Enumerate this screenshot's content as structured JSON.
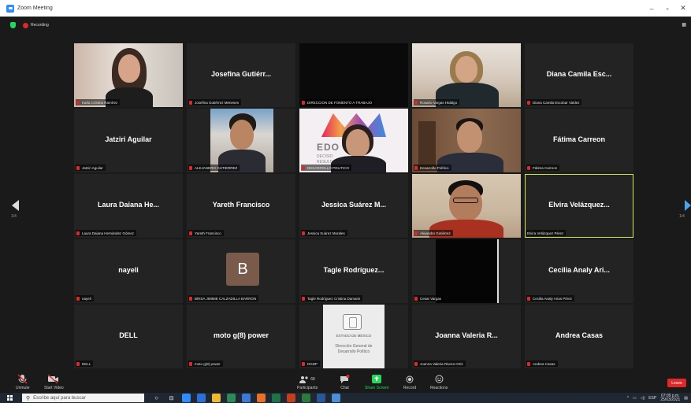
{
  "window": {
    "title": "Zoom Meeting",
    "minimize": "–",
    "maximize": "▫",
    "close": "✕"
  },
  "recording": {
    "label": "Recording"
  },
  "gallery": {
    "page_left": "1/4",
    "page_right": "1/4",
    "tiles": [
      {
        "label": "Karla Cristina Ramírez"
      },
      {
        "name": "Josefina Gutiérr...",
        "label": "Josefina Gutiérrez Meneses"
      },
      {
        "label": "DIRECCION DE FOMENTO A TRABAJO"
      },
      {
        "label": "Rosario Vargas Hidalgo"
      },
      {
        "name": "Diana Camila Esc...",
        "label": "Diana Camila Escobar Valdez"
      },
      {
        "name": "Jatziri Aguilar",
        "label": "Jatziri Aguilar"
      },
      {
        "label": "ALEJANDRO GUTIERREZ"
      },
      {
        "edo": "EDO",
        "edo_sub1": "DECISIO",
        "edo_sub2": "RESULT",
        "label": "DESARROLLO POLITICO"
      },
      {
        "label": "Desarrollo Político"
      },
      {
        "name": "Fátima Carreon",
        "label": "Fátima Carreon"
      },
      {
        "name": "Laura Daiana He...",
        "label": "Laura Daiana Hernández Gómez"
      },
      {
        "name": "Yareth Francisco",
        "label": "Yareth Francisco"
      },
      {
        "name": "Jessica Suárez M...",
        "label": "Jessica Suárez Morales"
      },
      {
        "label": "Alejandro Gutiérrez"
      },
      {
        "name": "Elvira Velázquez...",
        "label": "Elvira Velázquez Pérez"
      },
      {
        "name": "nayeli",
        "label": "nayeli"
      },
      {
        "avatar": "B",
        "label": "BRISA JIMMIE CALZADILLA BARRON"
      },
      {
        "name": "Tagle Rodríguez...",
        "label": "Tagle Rodríguez Cristina Damaris"
      },
      {
        "label": "Cesar Vargas"
      },
      {
        "name": "Cecilia Analy Ari...",
        "label": "Cecilia Analy Arias Pérez"
      },
      {
        "name": "DELL",
        "label": "DELL"
      },
      {
        "name": "moto g(8) power",
        "label": "moto g(8) power"
      },
      {
        "seal_title": "ESTADO DE MÉXICO",
        "seal_sub1": "Dirección General de",
        "seal_sub2": "Desarrollo Político",
        "label": "DGDP"
      },
      {
        "name": "Joanna Valeria R...",
        "label": "Joanna Valeria Rivera Ortiz"
      },
      {
        "name": "Andrea Casas",
        "label": "Andrea Casas"
      }
    ]
  },
  "toolbar": {
    "unmute": "Unmute",
    "start_video": "Start Video",
    "participants": "Participants",
    "participants_count": "68",
    "chat": "Chat",
    "share_screen": "Share Screen",
    "record": "Record",
    "reactions": "Reactions",
    "leave": "Leave"
  },
  "taskbar": {
    "search_placeholder": "Escribe aquí para buscar",
    "time": "07:09 p.m.",
    "date": "25/03/2021",
    "lang": "ESP"
  },
  "colors": {
    "accent": "#2d8cff",
    "record": "#e02828",
    "active_speaker": "#d6e84e",
    "share": "#23d959"
  }
}
